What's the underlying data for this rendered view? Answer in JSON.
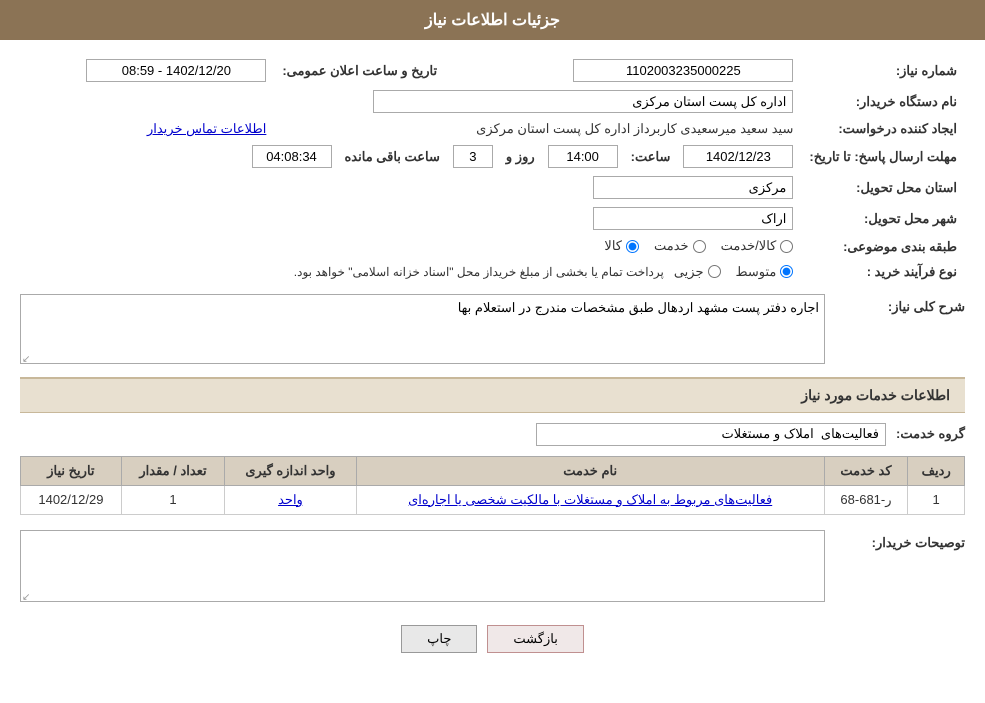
{
  "header": {
    "title": "جزئیات اطلاعات نیاز"
  },
  "fields": {
    "need_number_label": "شماره نیاز:",
    "need_number_value": "1102003235000225",
    "buyer_org_label": "نام دستگاه خریدار:",
    "buyer_org_value": "اداره کل پست استان مرکزی",
    "creator_label": "ایجاد کننده درخواست:",
    "creator_value": "سید سعید میرسعیدی کاربرداز اداره کل پست استان مرکزی",
    "creator_link": "اطلاعات تماس خریدار",
    "response_deadline_label": "مهلت ارسال پاسخ: تا تاریخ:",
    "deadline_date": "1402/12/23",
    "deadline_time_label": "ساعت:",
    "deadline_time": "14:00",
    "deadline_days_label": "روز و",
    "deadline_days": "3",
    "deadline_remaining_label": "ساعت باقی مانده",
    "deadline_remaining": "04:08:34",
    "announcement_label": "تاریخ و ساعت اعلان عمومی:",
    "announcement_value": "1402/12/20 - 08:59",
    "delivery_province_label": "استان محل تحویل:",
    "delivery_province_value": "مرکزی",
    "delivery_city_label": "شهر محل تحویل:",
    "delivery_city_value": "اراک",
    "subject_label": "طبقه بندی موضوعی:",
    "subject_options": [
      {
        "label": "کالا",
        "selected": true
      },
      {
        "label": "خدمت",
        "selected": false
      },
      {
        "label": "کالا/خدمت",
        "selected": false
      }
    ],
    "purchase_type_label": "نوع فرآیند خرید :",
    "purchase_options": [
      {
        "label": "جزیی",
        "selected": false
      },
      {
        "label": "متوسط",
        "selected": true
      }
    ],
    "purchase_note": "پرداخت تمام یا بخشی از مبلغ خریداز محل \"اسناد خزانه اسلامی\" خواهد بود.",
    "description_label": "شرح کلی نیاز:",
    "description_value": "اجاره دفتر پست مشهد اردهال طبق مشخصات مندرج در استعلام بها"
  },
  "services_section": {
    "title": "اطلاعات خدمات مورد نیاز",
    "service_group_label": "گروه خدمت:",
    "service_group_value": "فعالیت‌های املاک و مستغلات",
    "table": {
      "headers": [
        "ردیف",
        "کد خدمت",
        "نام خدمت",
        "واحد اندازه گیری",
        "تعداد / مقدار",
        "تاریخ نیاز"
      ],
      "rows": [
        {
          "row_num": "1",
          "service_code": "ر-681-68",
          "service_name": "فعالیت‌های مربوط به املاک و مستغلات با مالکیت شخصی یا اجاره‌ای",
          "unit": "واحد",
          "quantity": "1",
          "date": "1402/12/29"
        }
      ]
    }
  },
  "buyer_notes_label": "توصیحات خریدار:",
  "buttons": {
    "print": "چاپ",
    "back": "بازگشت"
  }
}
